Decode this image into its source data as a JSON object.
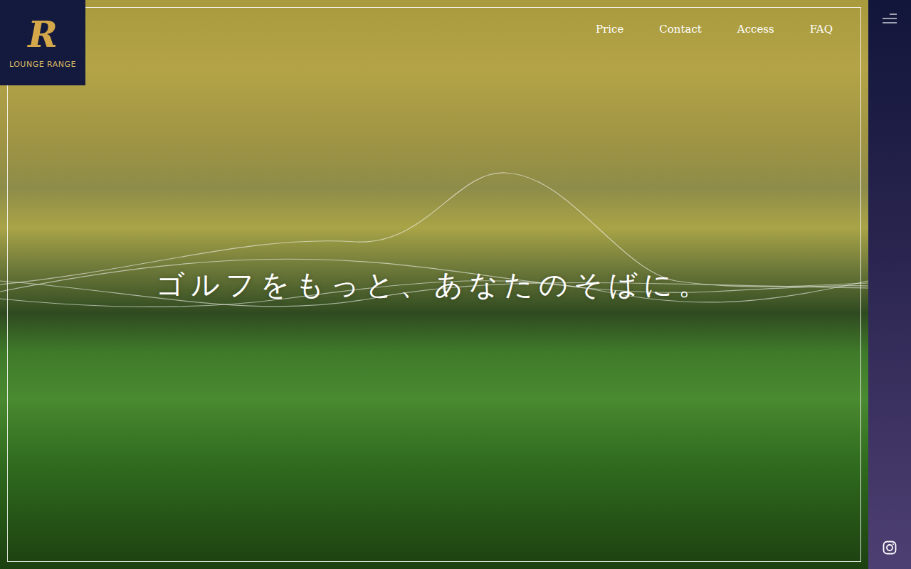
{
  "logo": {
    "mark": "R",
    "name": "LOUNGE RANGE"
  },
  "nav": [
    {
      "label": "Price"
    },
    {
      "label": "Contact"
    },
    {
      "label": "Access"
    },
    {
      "label": "FAQ"
    }
  ],
  "hero": {
    "headline": "ゴルフをもっと、あなたのそばに。"
  }
}
